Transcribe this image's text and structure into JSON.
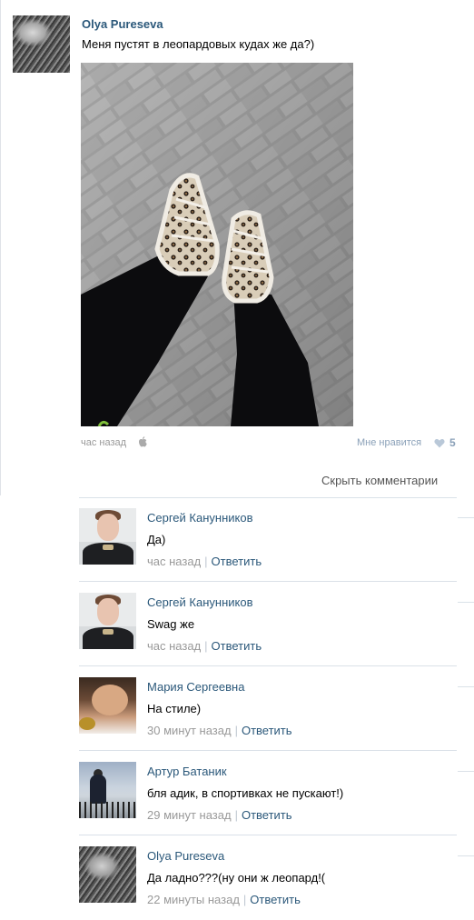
{
  "post": {
    "author": "Olya Pureseva",
    "text": "Меня пустят в леопардовых кудах же да?)",
    "time": "час назад",
    "like_label": "Мне нравится",
    "like_count": "5",
    "hide_comments": "Скрыть комментарии"
  },
  "comments": [
    {
      "author": "Сергей Канунников",
      "text": "Да)",
      "time": "час назад",
      "reply": "Ответить"
    },
    {
      "author": "Сергей Канунников",
      "text": "Swag же",
      "time": "час назад",
      "reply": "Ответить"
    },
    {
      "author": "Мария Сергеевна",
      "text": "На стиле)",
      "time": "30 минут назад",
      "reply": "Ответить"
    },
    {
      "author": "Артур Батаник",
      "text": "бля адик, в спортивках не пускают!)",
      "time": "29 минут назад",
      "reply": "Ответить"
    },
    {
      "author": "Olya Pureseva",
      "text": "Да ладно???(ну они ж леопард!(",
      "time": "22 минуты назад",
      "reply": "Ответить"
    }
  ],
  "icons": {
    "platform": "apple-icon",
    "like": "heart-icon"
  },
  "colors": {
    "link": "#2b587a",
    "muted": "#999999",
    "like": "#8aa0b8",
    "separator": "#dae1e8"
  }
}
